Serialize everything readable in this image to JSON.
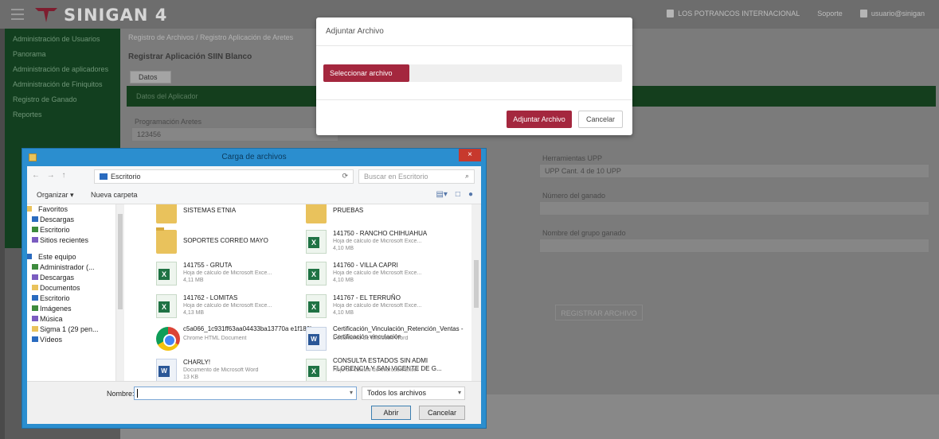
{
  "app": {
    "brand": "SINIGAN 4"
  },
  "topbar": {
    "user_items": [
      "LOS POTRANCOS INTERNACIONAL",
      "Soporte",
      "usuario@sinigan"
    ]
  },
  "sidebar": {
    "items": [
      {
        "label": "Administración de Usuarios"
      },
      {
        "label": "Panorama"
      },
      {
        "label": "Administración de aplicadores"
      },
      {
        "label": "Administración de Finiquitos"
      },
      {
        "label": "Registro de Ganado"
      },
      {
        "label": "Reportes"
      }
    ]
  },
  "main": {
    "breadcrumb": "Registro de Archivos / Registro Aplicación de Aretes",
    "page_title": "Registrar Aplicación SIIN Blanco",
    "tab": "Datos",
    "green_bar": "Datos del Aplicador",
    "field1_label": "Programación Aretes",
    "field1_value": "123456",
    "field2_label": "Herramientas UPP",
    "field2_value": "UPP Cant. 4 de 10 UPP",
    "field3_label": "Número del ganado",
    "field4_label": "Nombre del grupo ganado",
    "submit_label": "REGISTRAR ARCHIVO"
  },
  "modal": {
    "title": "Adjuntar Archivo",
    "select_label": "Seleccionar archivo",
    "attach_label": "Adjuntar Archivo",
    "cancel_label": "Cancelar"
  },
  "dialog": {
    "title": "Carga de archivos",
    "close": "×",
    "nav_arrows": "← → ↑",
    "address": "Escritorio",
    "refresh": "⟳",
    "search_placeholder": "Buscar en Escritorio",
    "organize": "Organizar ▾",
    "new_folder": "Nueva carpeta",
    "nav_pane": [
      {
        "label": "Favoritos",
        "type": "header"
      },
      {
        "label": "Descargas"
      },
      {
        "label": "Escritorio"
      },
      {
        "label": "Sitios recientes"
      },
      {
        "label": "",
        "type": "gap"
      },
      {
        "label": "Este equipo",
        "type": "header"
      },
      {
        "label": "Administrador (..."
      },
      {
        "label": "Descargas"
      },
      {
        "label": "Documentos"
      },
      {
        "label": "Escritorio"
      },
      {
        "label": "Imágenes"
      },
      {
        "label": "Música"
      },
      {
        "label": "Sigma 1 (29 pen..."
      },
      {
        "label": "Vídeos"
      }
    ],
    "files_left": [
      {
        "name": "SISTEMAS ETNIA",
        "sub1": "",
        "sub2": "",
        "icon": "folder"
      },
      {
        "name": "SOPORTES CORREO MAYO",
        "sub1": "",
        "sub2": "",
        "icon": "folder"
      },
      {
        "name": "141755 - GRUTA",
        "sub1": "Hoja de cálculo de Microsoft Exce...",
        "sub2": "4,11 MB",
        "icon": "excel"
      },
      {
        "name": "141762 - LOMITAS",
        "sub1": "Hoja de cálculo de Microsoft Exce...",
        "sub2": "4,13 MB",
        "icon": "excel"
      },
      {
        "name": "c5a066_1c931ff63aa04433ba13770a e1f186b",
        "sub1": "Chrome HTML Document",
        "sub2": "",
        "icon": "chrome"
      },
      {
        "name": "CHARLY!",
        "sub1": "Documento de Microsoft Word",
        "sub2": "13 KB",
        "icon": "word"
      }
    ],
    "files_right": [
      {
        "name": "PRUEBAS",
        "sub1": "",
        "sub2": "",
        "icon": "folder"
      },
      {
        "name": "141750 - RANCHO CHIHUAHUA",
        "sub1": "Hoja de cálculo de Microsoft Exce...",
        "sub2": "4,10 MB",
        "icon": "excel"
      },
      {
        "name": "141760 - VILLA CAPRI",
        "sub1": "Hoja de cálculo de Microsoft Exce...",
        "sub2": "4,10 MB",
        "icon": "excel"
      },
      {
        "name": "141767 - EL TERRUÑO",
        "sub1": "Hoja de cálculo de Microsoft Exce...",
        "sub2": "4,10 MB",
        "icon": "excel"
      },
      {
        "name": "Certificación_Vinculación_Retención_Ventas - Certificación vinculación",
        "sub1": "Documento de Microsoft Word",
        "sub2": "",
        "icon": "word"
      },
      {
        "name": "CONSULTA ESTADOS SIN ADMI FLORENCIA Y SAN VICENTE DE G...",
        "sub1": "Hoja de cálculo de Microsoft Excel",
        "sub2": "",
        "icon": "excel"
      }
    ],
    "name_label": "Nombre:",
    "name_value": "",
    "filter": "Todos los archivos",
    "open_label": "Abrir",
    "cancel_label": "Cancelar"
  }
}
